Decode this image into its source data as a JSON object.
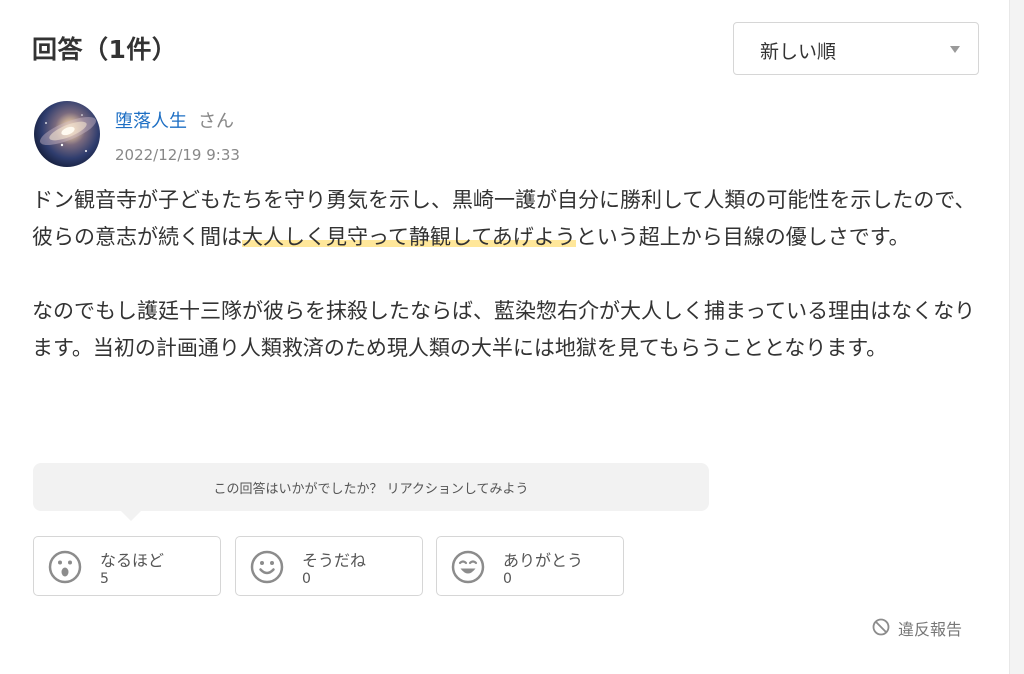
{
  "header": {
    "title": "回答（1件）",
    "sort": {
      "selected": "新しい順"
    }
  },
  "answer": {
    "author": {
      "name": "堕落人生",
      "suffix": "さん"
    },
    "date": "2022/12/19 9:33",
    "paragraph1": {
      "before": "ドン観音寺が子どもたちを守り勇気を示し、黒崎一護が自分に勝利して人類の可能性を示したので、彼らの意志が続く間は",
      "highlight": "大人しく見守って静観してあげよう",
      "after": "という超上から目線の優しさです。"
    },
    "paragraph2": "なのでもし護廷十三隊が彼らを抹殺したならば、藍染惣右介が大人しく捕まっている理由はなくなります。当初の計画通り人類救済のため現人類の大半には地獄を見てもらうこととなります。"
  },
  "reactions": {
    "prompt": "この回答はいかがでしたか？ リアクションしてみよう",
    "items": [
      {
        "label": "なるほど",
        "count": "5",
        "icon": "surprised-face-icon"
      },
      {
        "label": "そうだね",
        "count": "0",
        "icon": "smile-face-icon"
      },
      {
        "label": "ありがとう",
        "count": "0",
        "icon": "grin-face-icon"
      }
    ]
  },
  "report": {
    "label": "違反報告",
    "icon": "ban-icon"
  },
  "colors": {
    "link": "#1e6fc4",
    "highlight": "#ffe79a",
    "icon_gray": "#8c8c8c"
  }
}
